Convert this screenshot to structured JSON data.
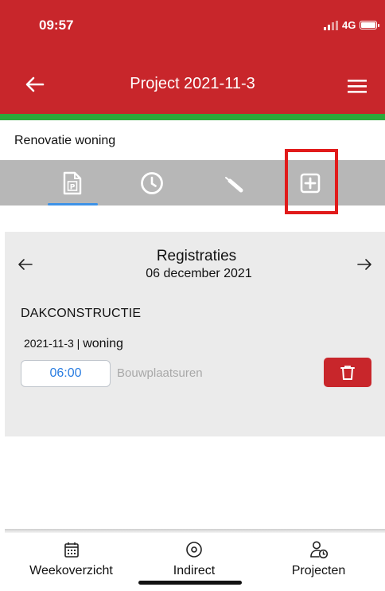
{
  "status_bar": {
    "time": "09:57",
    "network": "4G"
  },
  "header": {
    "title": "Project 2021-11-3"
  },
  "project": {
    "name": "Renovatie woning"
  },
  "tabs": [
    {
      "icon": "document-p-icon",
      "active": true
    },
    {
      "icon": "clock-icon",
      "active": false
    },
    {
      "icon": "screwdriver-icon",
      "active": false
    },
    {
      "icon": "plus-square-icon",
      "active": false
    }
  ],
  "registrations": {
    "title": "Registraties",
    "date": "06 december 2021",
    "group_title": "DAKCONSTRUCTIE",
    "entry": {
      "code": "2021-11-3 |",
      "name": "woning",
      "hours": "06:00",
      "hours_label": "Bouwplaatsuren"
    }
  },
  "bottom_nav": [
    {
      "label": "Weekoverzicht",
      "icon": "calendar-icon"
    },
    {
      "label": "Indirect",
      "icon": "target-icon"
    },
    {
      "label": "Projecten",
      "icon": "user-clock-icon"
    }
  ],
  "colors": {
    "brand_red": "#c8262b",
    "accent_green": "#2ea83a",
    "tab_bar_gray": "#b7b7b7",
    "active_blue": "#3e92e6",
    "highlight_red": "#e11b1b"
  }
}
